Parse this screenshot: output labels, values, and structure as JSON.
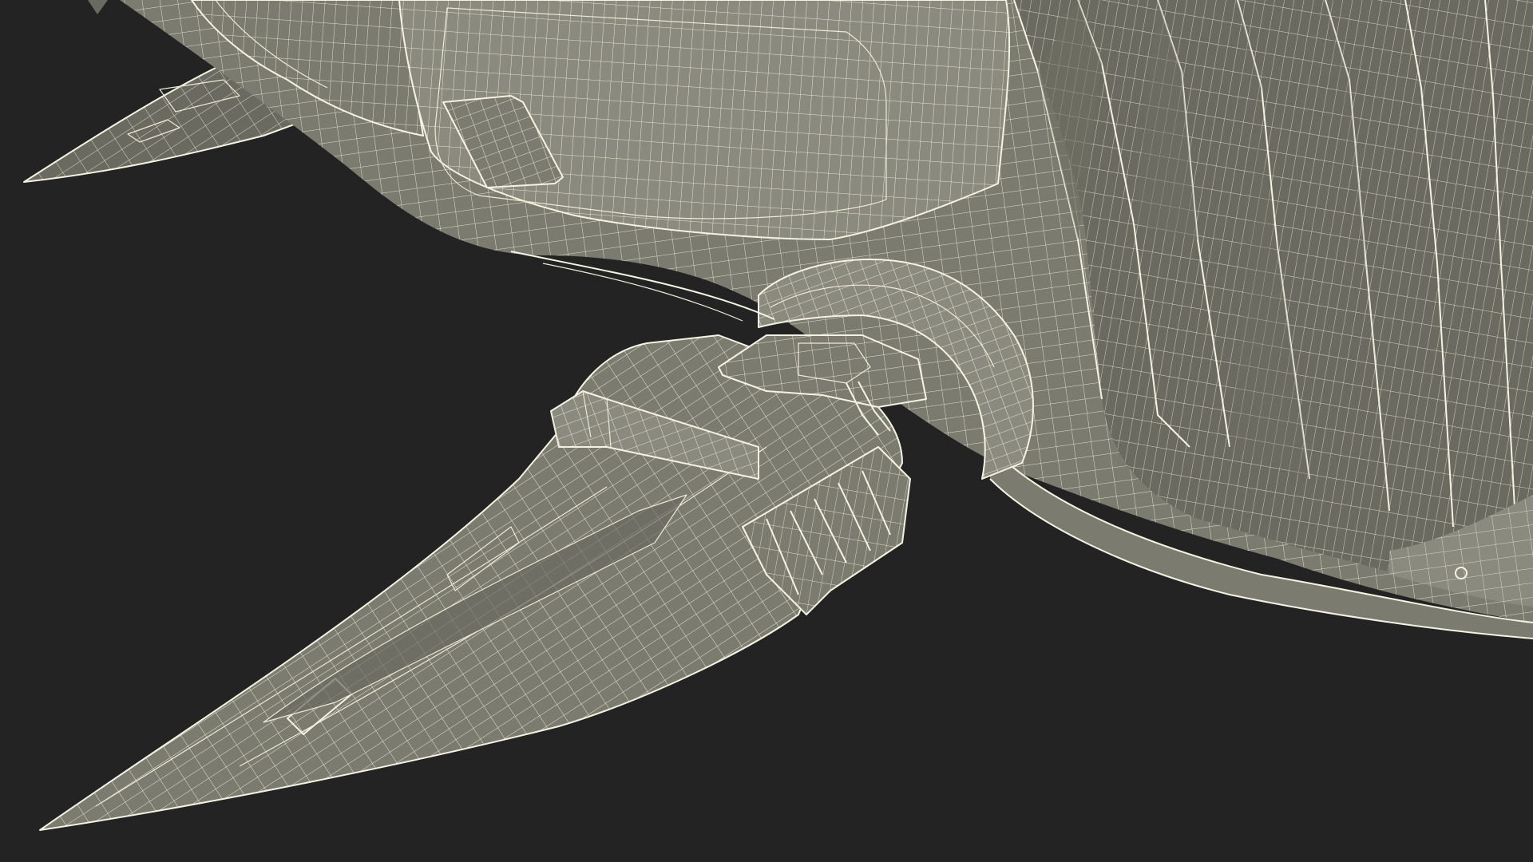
{
  "scene": {
    "background_color": "#232323",
    "surface_color": "#7b7b70",
    "surface_light_color": "#8a8a7f",
    "surface_dark_color": "#6a6a60",
    "wire_color": "#ecebd6",
    "edge_color": "#f4f3e2"
  }
}
